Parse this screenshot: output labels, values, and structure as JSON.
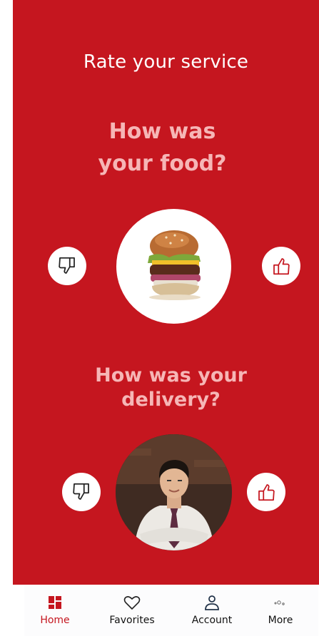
{
  "header": {
    "title": "Rate your service"
  },
  "food_section": {
    "question": "How was\nyour food?"
  },
  "delivery_section": {
    "question": "How was your\ndelivery?"
  },
  "nav": {
    "items": [
      {
        "label": "Home",
        "icon": "dashboard-icon",
        "active": true
      },
      {
        "label": "Favorites",
        "icon": "heart-icon",
        "active": false
      },
      {
        "label": "Account",
        "icon": "user-icon",
        "active": false
      },
      {
        "label": "More",
        "icon": "more-icon",
        "active": false
      }
    ]
  },
  "colors": {
    "primary": "#c5161f",
    "question_text": "#f6b6b6",
    "nav_active": "#c5161f"
  }
}
